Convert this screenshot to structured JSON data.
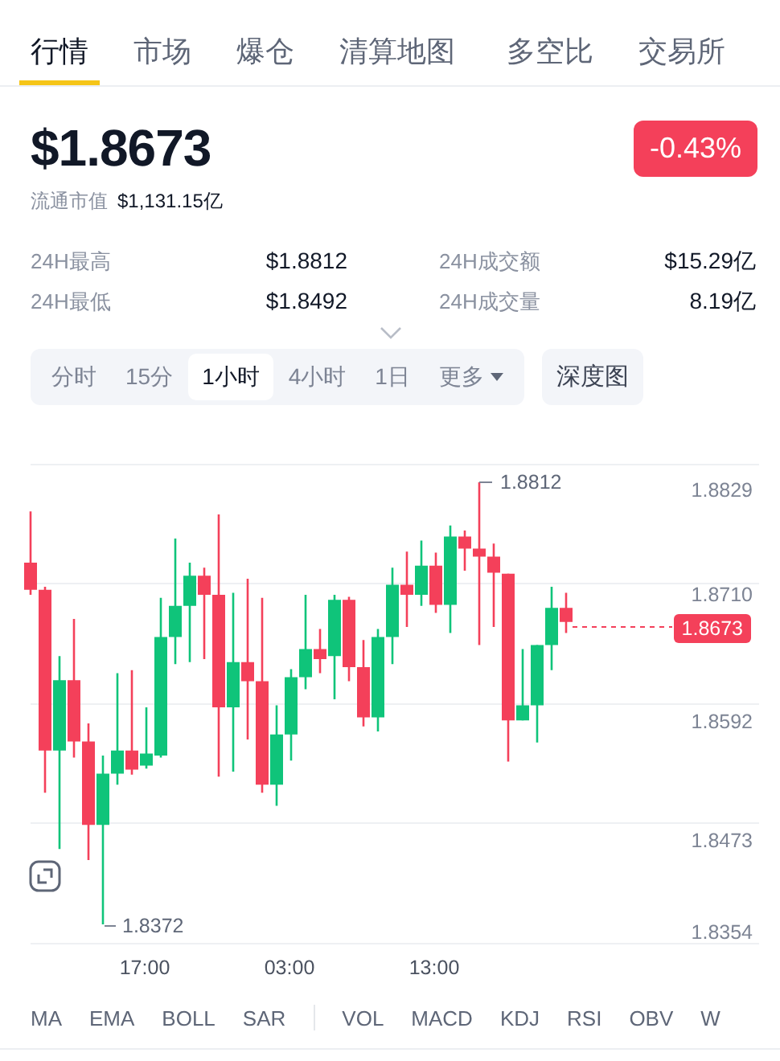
{
  "tabs": [
    {
      "label": "行情",
      "selected": true
    },
    {
      "label": "市场",
      "selected": false
    },
    {
      "label": "爆仓",
      "selected": false
    },
    {
      "label": "清算地图",
      "selected": false
    },
    {
      "label": "多空比",
      "selected": false
    },
    {
      "label": "交易所",
      "selected": false
    }
  ],
  "price": "$1.8673",
  "change": {
    "text": "-0.43%"
  },
  "market_cap": {
    "label": "流通市值",
    "value": "$1,131.15亿"
  },
  "stats": [
    {
      "label": "24H最高",
      "value": "$1.8812"
    },
    {
      "label": "24H成交额",
      "value": "$15.29亿"
    },
    {
      "label": "24H最低",
      "value": "$1.8492"
    },
    {
      "label": "24H成交量",
      "value": "8.19亿"
    }
  ],
  "timeframes": [
    {
      "label": "分时",
      "selected": false,
      "kind": "option"
    },
    {
      "label": "15分",
      "selected": false,
      "kind": "option"
    },
    {
      "label": "1小时",
      "selected": true,
      "kind": "option"
    },
    {
      "label": "4小时",
      "selected": false,
      "kind": "option"
    },
    {
      "label": "1日",
      "selected": false,
      "kind": "option"
    },
    {
      "label": "更多",
      "selected": false,
      "kind": "menu"
    }
  ],
  "depth_button": "深度图",
  "chart": {
    "chart_data": {
      "type": "candlestick",
      "ohlc": [
        [
          1.8732,
          1.8783,
          1.87,
          1.8705
        ],
        [
          1.8705,
          1.8708,
          1.8503,
          1.8545
        ],
        [
          1.8545,
          1.8639,
          1.8447,
          1.8615
        ],
        [
          1.8615,
          1.8676,
          1.8538,
          1.8554
        ],
        [
          1.8554,
          1.8572,
          1.8436,
          1.8471
        ],
        [
          1.8471,
          1.854,
          1.8372,
          1.8522
        ],
        [
          1.8522,
          1.8622,
          1.8511,
          1.8545
        ],
        [
          1.8545,
          1.8625,
          1.8521,
          1.8526
        ],
        [
          1.853,
          1.8588,
          1.8527,
          1.8542
        ],
        [
          1.854,
          1.8697,
          1.8538,
          1.8658
        ],
        [
          1.8658,
          1.8756,
          1.8631,
          1.8689
        ],
        [
          1.8689,
          1.8732,
          1.8633,
          1.8719
        ],
        [
          1.8719,
          1.8727,
          1.8636,
          1.87
        ],
        [
          1.87,
          1.878,
          1.8519,
          1.8588
        ],
        [
          1.8588,
          1.8702,
          1.8524,
          1.8633
        ],
        [
          1.8633,
          1.8716,
          1.8556,
          1.8614
        ],
        [
          1.8614,
          1.8697,
          1.8503,
          1.8511
        ],
        [
          1.8511,
          1.859,
          1.849,
          1.8561
        ],
        [
          1.8561,
          1.8626,
          1.8535,
          1.8618
        ],
        [
          1.8618,
          1.87,
          1.8606,
          1.8646
        ],
        [
          1.8646,
          1.8666,
          1.8622,
          1.8636
        ],
        [
          1.8639,
          1.87,
          1.8596,
          1.8695
        ],
        [
          1.8695,
          1.8698,
          1.8614,
          1.8628
        ],
        [
          1.8628,
          1.8655,
          1.8569,
          1.8578
        ],
        [
          1.8578,
          1.8666,
          1.8564,
          1.8658
        ],
        [
          1.8658,
          1.8727,
          1.8631,
          1.871
        ],
        [
          1.871,
          1.8743,
          1.8668,
          1.87
        ],
        [
          1.87,
          1.8754,
          1.8689,
          1.8729
        ],
        [
          1.8729,
          1.8742,
          1.8682,
          1.869
        ],
        [
          1.869,
          1.8769,
          1.8662,
          1.8758
        ],
        [
          1.8758,
          1.8764,
          1.8724,
          1.8746
        ],
        [
          1.8746,
          1.8812,
          1.865,
          1.8738
        ],
        [
          1.8738,
          1.8751,
          1.8668,
          1.8722
        ],
        [
          1.8721,
          1.8721,
          1.8534,
          1.8575
        ],
        [
          1.8575,
          1.8646,
          1.8575,
          1.859
        ],
        [
          1.859,
          1.865,
          1.8553,
          1.865
        ],
        [
          1.865,
          1.8708,
          1.8625,
          1.8687
        ],
        [
          1.8687,
          1.8702,
          1.8662,
          1.8673
        ]
      ]
    },
    "y_labels": [
      "1.8829",
      "1.8710",
      "1.8592",
      "1.8473",
      "1.8354"
    ],
    "x_labels": [
      "17:00",
      "03:00",
      "13:00"
    ],
    "high_label": "1.8812",
    "low_label": "1.8372",
    "current_price": "1.8673"
  },
  "overlay_indicators": [
    "MA",
    "EMA",
    "BOLL",
    "SAR"
  ],
  "sub_indicators": [
    "VOL",
    "MACD",
    "KDJ",
    "RSI",
    "OBV",
    "W"
  ]
}
